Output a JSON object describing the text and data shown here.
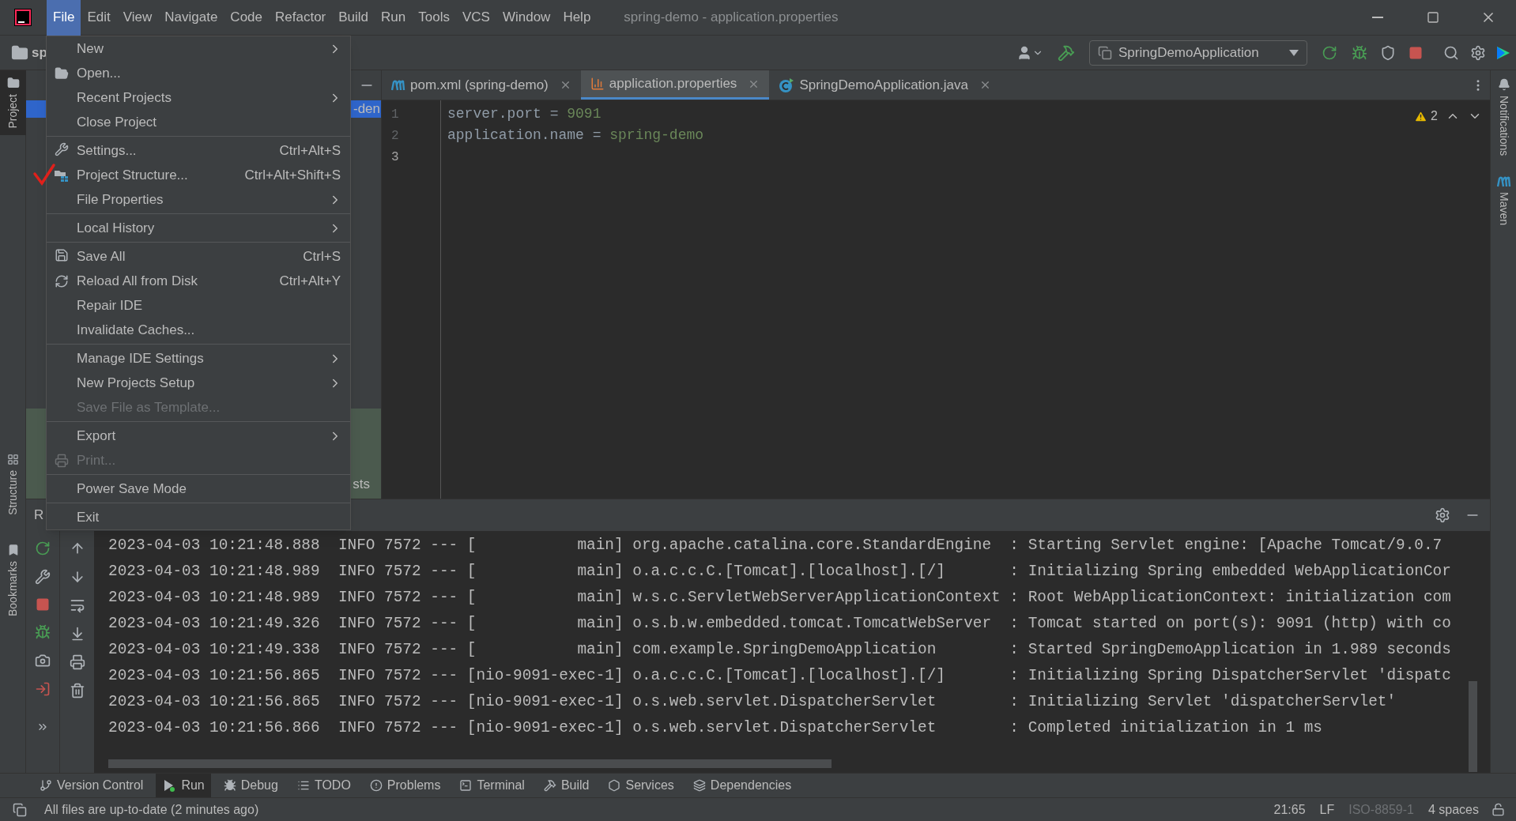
{
  "window": {
    "title": "spring-demo - application.properties"
  },
  "menubar": [
    {
      "label": "File",
      "selected": true
    },
    {
      "label": "Edit",
      "selected": false
    },
    {
      "label": "View",
      "selected": false
    },
    {
      "label": "Navigate",
      "selected": false
    },
    {
      "label": "Code",
      "selected": false
    },
    {
      "label": "Refactor",
      "selected": false
    },
    {
      "label": "Build",
      "selected": false
    },
    {
      "label": "Run",
      "selected": false
    },
    {
      "label": "Tools",
      "selected": false
    },
    {
      "label": "VCS",
      "selected": false
    },
    {
      "label": "Window",
      "selected": false
    },
    {
      "label": "Help",
      "selected": false
    }
  ],
  "breadcrumb": "sp",
  "run_config": "SpringDemoApplication",
  "file_menu": [
    {
      "label": "New",
      "submenu": true,
      "disabled": false,
      "kind": "none",
      "group_start": false,
      "marked": false
    },
    {
      "label": "Open...",
      "submenu": false,
      "disabled": false,
      "kind": "folder",
      "group_start": false,
      "marked": false
    },
    {
      "label": "Recent Projects",
      "submenu": true,
      "disabled": false,
      "kind": "none",
      "group_start": false,
      "marked": false
    },
    {
      "label": "Close Project",
      "submenu": false,
      "disabled": false,
      "kind": "none",
      "group_start": false,
      "marked": false
    },
    {
      "label": "Settings...",
      "shortcut": "Ctrl+Alt+S",
      "submenu": false,
      "disabled": false,
      "kind": "wrench",
      "group_start": true,
      "marked": false
    },
    {
      "label": "Project Structure...",
      "shortcut": "Ctrl+Alt+Shift+S",
      "submenu": false,
      "disabled": false,
      "kind": "structure",
      "group_start": false,
      "marked": true
    },
    {
      "label": "File Properties",
      "submenu": true,
      "disabled": false,
      "kind": "none",
      "group_start": false,
      "marked": false
    },
    {
      "label": "Local History",
      "submenu": true,
      "disabled": false,
      "kind": "none",
      "group_start": true,
      "marked": false
    },
    {
      "label": "Save All",
      "shortcut": "Ctrl+S",
      "submenu": false,
      "disabled": false,
      "kind": "save",
      "group_start": true,
      "marked": false
    },
    {
      "label": "Reload All from Disk",
      "shortcut": "Ctrl+Alt+Y",
      "submenu": false,
      "disabled": false,
      "kind": "reload",
      "group_start": false,
      "marked": false
    },
    {
      "label": "Repair IDE",
      "submenu": false,
      "disabled": false,
      "kind": "none",
      "group_start": false,
      "marked": false
    },
    {
      "label": "Invalidate Caches...",
      "submenu": false,
      "disabled": false,
      "kind": "none",
      "group_start": false,
      "marked": false
    },
    {
      "label": "Manage IDE Settings",
      "submenu": true,
      "disabled": false,
      "kind": "none",
      "group_start": true,
      "marked": false
    },
    {
      "label": "New Projects Setup",
      "submenu": true,
      "disabled": false,
      "kind": "none",
      "group_start": false,
      "marked": false
    },
    {
      "label": "Save File as Template...",
      "submenu": false,
      "disabled": true,
      "kind": "none",
      "group_start": false,
      "marked": false
    },
    {
      "label": "Export",
      "submenu": true,
      "disabled": false,
      "kind": "none",
      "group_start": true,
      "marked": false
    },
    {
      "label": "Print...",
      "submenu": false,
      "disabled": true,
      "kind": "printer",
      "group_start": false,
      "marked": false
    },
    {
      "label": "Power Save Mode",
      "submenu": false,
      "disabled": false,
      "kind": "none",
      "group_start": true,
      "marked": false
    },
    {
      "label": "Exit",
      "submenu": false,
      "disabled": false,
      "kind": "none",
      "group_start": true,
      "marked": false
    }
  ],
  "left_strip": [
    {
      "label": "Project",
      "selected": true,
      "kind": "project"
    },
    {
      "label": "Structure",
      "selected": false,
      "kind": "structure"
    },
    {
      "label": "Bookmarks",
      "selected": false,
      "kind": "bookmarks"
    }
  ],
  "right_strip": [
    {
      "label": "Notifications",
      "kind": "notifications"
    },
    {
      "label": "Maven",
      "kind": "maven"
    }
  ],
  "project_panel": {
    "row_text": "-den",
    "footer_text": "sts"
  },
  "editor_tabs": [
    {
      "label": "pom.xml (spring-demo)",
      "kind": "maven",
      "selected": false
    },
    {
      "label": "application.properties",
      "kind": "properties",
      "selected": true
    },
    {
      "label": "SpringDemoApplication.java",
      "kind": "java",
      "selected": false
    }
  ],
  "editor": {
    "warnings": "2",
    "lines": [
      {
        "number": "1",
        "key": "server.port",
        "separator": " = ",
        "value": "9091",
        "current": false
      },
      {
        "number": "2",
        "key": "application.name",
        "separator": " = ",
        "value": "spring-demo",
        "current": false
      },
      {
        "number": "3",
        "current": true
      }
    ]
  },
  "run_panel": {
    "title": "R",
    "console": [
      "2023-04-03 10:21:48.888  INFO 7572 --- [           main] org.apache.catalina.core.StandardEngine  : Starting Servlet engine: [Apache Tomcat/9.0.7",
      "2023-04-03 10:21:48.989  INFO 7572 --- [           main] o.a.c.c.C.[Tomcat].[localhost].[/]       : Initializing Spring embedded WebApplicationCor",
      "2023-04-03 10:21:48.989  INFO 7572 --- [           main] w.s.c.ServletWebServerApplicationContext : Root WebApplicationContext: initialization com",
      "2023-04-03 10:21:49.326  INFO 7572 --- [           main] o.s.b.w.embedded.tomcat.TomcatWebServer  : Tomcat started on port(s): 9091 (http) with co",
      "2023-04-03 10:21:49.338  INFO 7572 --- [           main] com.example.SpringDemoApplication        : Started SpringDemoApplication in 1.989 seconds",
      "2023-04-03 10:21:56.865  INFO 7572 --- [nio-9091-exec-1] o.a.c.c.C.[Tomcat].[localhost].[/]       : Initializing Spring DispatcherServlet 'dispatc",
      "2023-04-03 10:21:56.865  INFO 7572 --- [nio-9091-exec-1] o.s.web.servlet.DispatcherServlet        : Initializing Servlet 'dispatcherServlet'",
      "2023-04-03 10:21:56.866  INFO 7572 --- [nio-9091-exec-1] o.s.web.servlet.DispatcherServlet        : Completed initialization in 1 ms"
    ]
  },
  "tool_tabs": [
    {
      "label": "Version Control",
      "kind": "vcs",
      "selected": false
    },
    {
      "label": "Run",
      "kind": "run",
      "selected": true
    },
    {
      "label": "Debug",
      "kind": "debug",
      "selected": false
    },
    {
      "label": "TODO",
      "kind": "todo",
      "selected": false
    },
    {
      "label": "Problems",
      "kind": "problems",
      "selected": false
    },
    {
      "label": "Terminal",
      "kind": "terminal",
      "selected": false
    },
    {
      "label": "Build",
      "kind": "build",
      "selected": false
    },
    {
      "label": "Services",
      "kind": "services",
      "selected": false
    },
    {
      "label": "Dependencies",
      "kind": "dependencies",
      "selected": false
    }
  ],
  "status_bar": {
    "message": "All files are up-to-date (2 minutes ago)",
    "items": [
      {
        "label": "21:65",
        "disabled": false
      },
      {
        "label": "LF",
        "disabled": false
      },
      {
        "label": "ISO-8859-1",
        "disabled": true
      },
      {
        "label": "4 spaces",
        "disabled": false
      }
    ]
  }
}
